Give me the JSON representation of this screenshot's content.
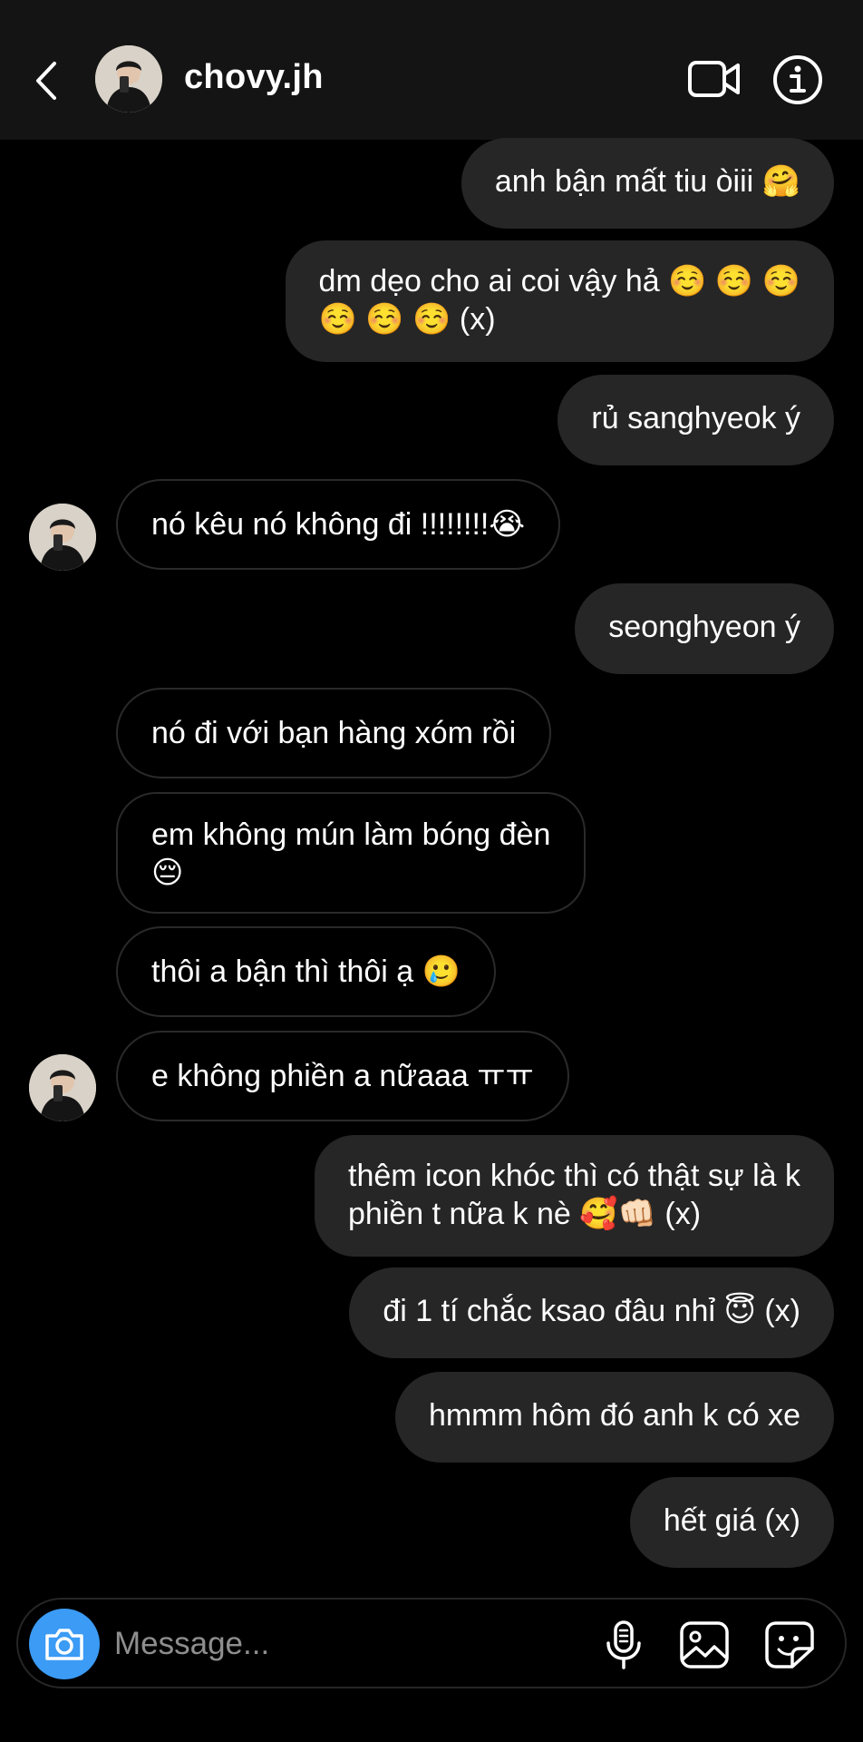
{
  "header": {
    "username": "chovy.jh",
    "icons": [
      "back-chevron-icon",
      "avatar",
      "video-call-icon",
      "info-icon"
    ]
  },
  "messages": [
    {
      "side": "sent",
      "text": "anh bận mất tiu òiii 🤗"
    },
    {
      "side": "sent",
      "line1": "dm dẹo cho ai coi vậy hả ☺️ ☺️ ☺️",
      "line2": "☺️ ☺️ ☺️ (x)"
    },
    {
      "side": "sent",
      "text": "rủ sanghyeok ý"
    },
    {
      "side": "received",
      "text": "nó kêu nó không đi !!!!!!!!😭"
    },
    {
      "side": "sent",
      "text": "seonghyeon ý"
    },
    {
      "side": "received",
      "text": "nó đi với bạn hàng xóm rồi"
    },
    {
      "side": "received",
      "line1": "em không mún làm bóng đèn",
      "line2": "😔"
    },
    {
      "side": "received",
      "text": "thôi a bận thì thôi ạ 🥲"
    },
    {
      "side": "received",
      "text": "e không phiền a nữaaa ㅠㅠ"
    },
    {
      "side": "sent",
      "line1": "thêm icon khóc thì có thật sự là k",
      "line2": "phiền t nữa k nè 🥰👊🏻 (x)"
    },
    {
      "side": "sent",
      "text": "đi 1 tí chắc ksao đâu nhỉ 😇 (x)"
    },
    {
      "side": "sent",
      "text": "hmmm hôm đó anh k có xe"
    },
    {
      "side": "sent",
      "text": "hết giá (x)"
    }
  ],
  "composer": {
    "placeholder": "Message...",
    "icons": [
      "camera-icon",
      "microphone-icon",
      "gallery-icon",
      "sticker-icon"
    ]
  },
  "colors": {
    "background": "#000000",
    "header": "#141414",
    "sent_bubble": "#262626",
    "received_border": "#2a2a2a",
    "camera_button": "#3b9bf5",
    "placeholder": "#8e8e8e"
  }
}
